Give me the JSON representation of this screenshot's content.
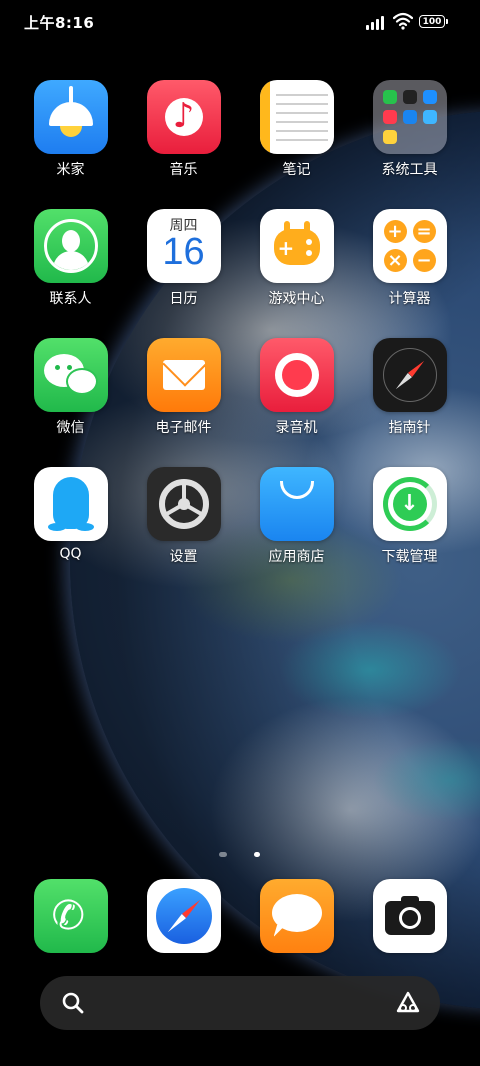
{
  "status_bar": {
    "time": "上午8:16",
    "battery": "100"
  },
  "apps": {
    "mijia": "米家",
    "music": "音乐",
    "notes": "笔记",
    "system_tools": "系统工具",
    "contacts": "联系人",
    "calendar": "日历",
    "calendar_weekday": "周四",
    "calendar_day": "16",
    "game_center": "游戏中心",
    "calculator": "计算器",
    "wechat": "微信",
    "email": "电子邮件",
    "recorder": "录音机",
    "compass": "指南针",
    "qq": "QQ",
    "settings": "设置",
    "app_store": "应用商店",
    "downloads": "下载管理"
  },
  "dock": {
    "phone": "phone-icon",
    "browser": "browser-icon",
    "messages": "messages-icon",
    "camera": "camera-icon"
  },
  "search": {
    "placeholder": ""
  },
  "page_indicator": {
    "pages": 2,
    "current": 2
  },
  "colors": {
    "green": "#21b94b",
    "red": "#e91e3c",
    "orange": "#ff8110",
    "blue": "#1a85f0"
  }
}
